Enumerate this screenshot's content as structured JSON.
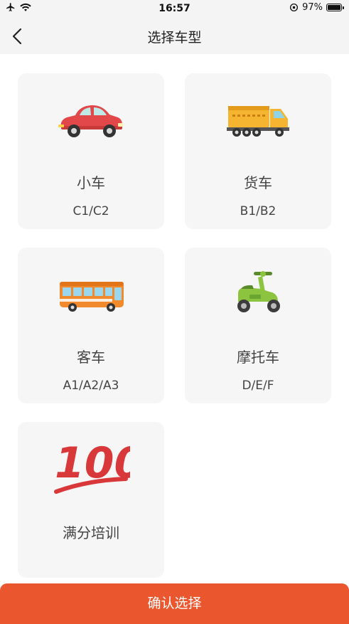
{
  "status": {
    "time": "16:57",
    "battery": "97%",
    "battery_level": 0.97
  },
  "nav": {
    "title": "选择车型"
  },
  "cards": [
    {
      "name": "小车",
      "code": "C1/C2"
    },
    {
      "name": "货车",
      "code": "B1/B2"
    },
    {
      "name": "客车",
      "code": "A1/A2/A3"
    },
    {
      "name": "摩托车",
      "code": "D/E/F"
    },
    {
      "name": "满分培训",
      "badge": "100"
    }
  ],
  "confirm": {
    "label": "确认选择"
  },
  "colors": {
    "accent": "#ea562d",
    "card_bg": "#f6f6f6"
  }
}
